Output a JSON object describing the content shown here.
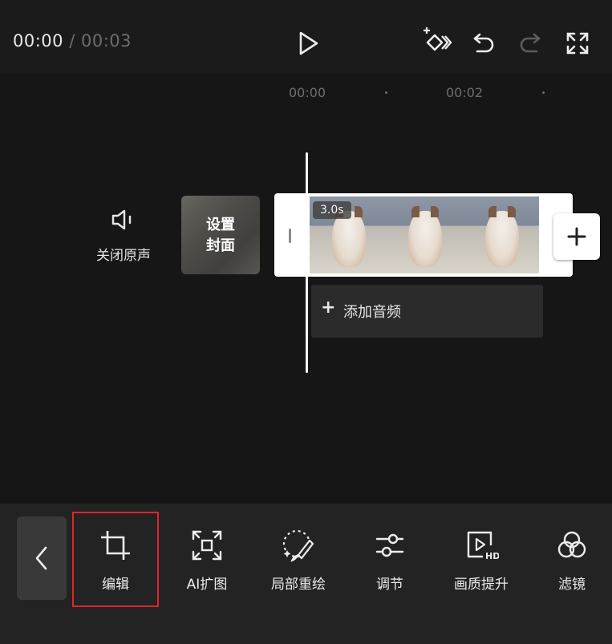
{
  "header": {
    "current_time": "00:00",
    "separator": "/",
    "total_time": "00:03"
  },
  "ruler": {
    "marks": [
      "00:00",
      "00:02"
    ]
  },
  "timeline": {
    "mute_label": "关闭原声",
    "cover_label": "设置\n封面",
    "clip_duration": "3.0s",
    "add_audio_label": "添加音频"
  },
  "toolbar": {
    "tools": [
      {
        "label": "编辑",
        "icon": "crop-icon"
      },
      {
        "label": "AI扩图",
        "icon": "ai-expand-icon"
      },
      {
        "label": "局部重绘",
        "icon": "brush-icon"
      },
      {
        "label": "调节",
        "icon": "sliders-icon"
      },
      {
        "label": "画质提升",
        "icon": "hd-icon"
      },
      {
        "label": "滤镜",
        "icon": "filter-icon"
      }
    ]
  },
  "colors": {
    "background": "#161616",
    "toolbar": "#232323",
    "highlight": "#e0262b"
  }
}
